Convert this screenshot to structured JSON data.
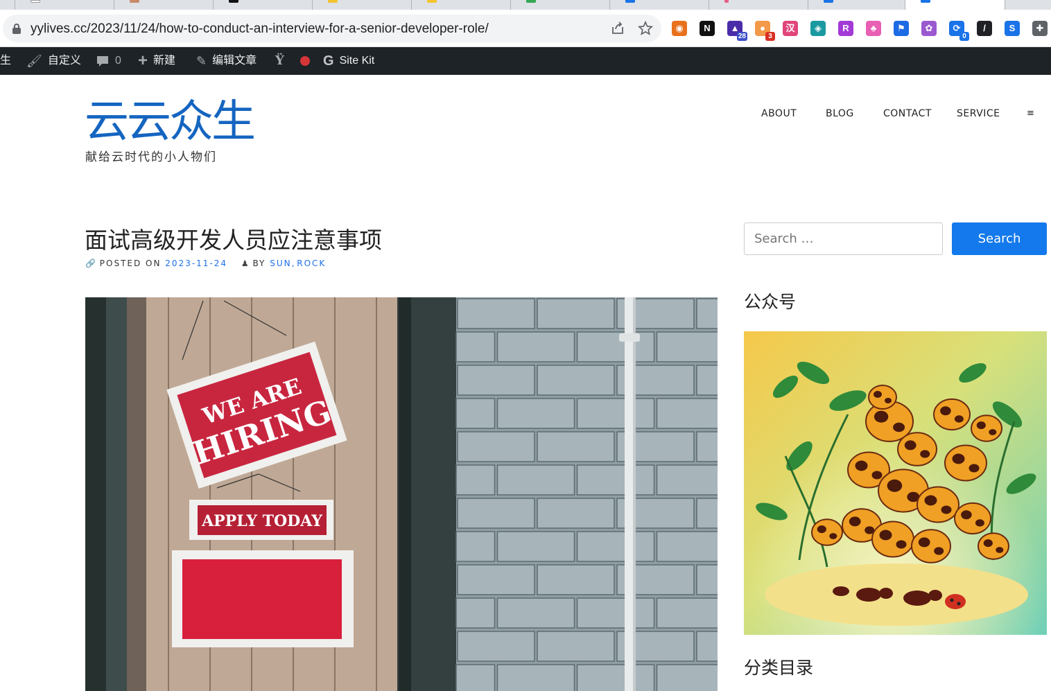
{
  "browser": {
    "url": "yylives.cc/2023/11/24/how-to-conduct-an-interview-for-a-senior-developer-role/",
    "extensions": [
      {
        "name": "circle-extension-icon",
        "color": "#e8711c",
        "glyph": "◉",
        "badge": ""
      },
      {
        "name": "notion-extension-icon",
        "color": "#111111",
        "glyph": "N",
        "badge": ""
      },
      {
        "name": "graduation-cap-extension-icon",
        "color": "#4b2ca8",
        "glyph": "▲",
        "badge": "28",
        "badge_color": "#3c4ec9"
      },
      {
        "name": "cloud-extension-icon",
        "color": "#f2994a",
        "glyph": "●",
        "badge": "3",
        "badge_color": "#d93025"
      },
      {
        "name": "translate-extension-icon",
        "color": "#e0457b",
        "glyph": "汉",
        "badge": ""
      },
      {
        "name": "gem-extension-icon",
        "color": "#1a9aa0",
        "glyph": "◈",
        "badge": ""
      },
      {
        "name": "lr-extension-icon",
        "color": "#a33ad6",
        "glyph": "R",
        "badge": ""
      },
      {
        "name": "paw-extension-icon",
        "color": "#e85fb4",
        "glyph": "♣",
        "badge": ""
      },
      {
        "name": "flag-extension-icon",
        "color": "#1d6ae5",
        "glyph": "⚑",
        "badge": ""
      },
      {
        "name": "openai-extension-icon",
        "color": "#9b59d0",
        "glyph": "✿",
        "badge": ""
      },
      {
        "name": "sync-extension-icon",
        "color": "#1a73e8",
        "glyph": "⟳",
        "badge": "0",
        "badge_color": "#1a73e8"
      },
      {
        "name": "slash-extension-icon",
        "color": "#202124",
        "glyph": "/",
        "badge": ""
      },
      {
        "name": "s-extension-icon",
        "color": "#1a73e8",
        "glyph": "S",
        "badge": ""
      },
      {
        "name": "puzzle-extension-icon",
        "color": "#5f6368",
        "glyph": "✚",
        "badge": ""
      }
    ]
  },
  "adminbar": {
    "site_fragment": "生",
    "customize": "自定义",
    "comments_count": "0",
    "new": "新建",
    "edit_post": "编辑文章",
    "sitekit": "Site Kit"
  },
  "site": {
    "title": "云云众生",
    "description": "献给云时代的小人物们"
  },
  "nav": {
    "about": "ABOUT",
    "blog": "BLOG",
    "contact": "CONTACT",
    "service": "SERVICE",
    "menu": "≡"
  },
  "post": {
    "title": "面试高级开发人员应注意事项",
    "posted_on_label": "POSTED ON",
    "date": "2023-11-24",
    "by_label": "BY",
    "author1": "SUN",
    "sep": ", ",
    "author2": "ROCK",
    "image": {
      "sign_line1": "WE ARE",
      "sign_line2": "HIRING",
      "apply_text": "APPLY TODAY"
    }
  },
  "sidebar": {
    "search_placeholder": "Search …",
    "search_button": "Search",
    "widget1_title": "公众号",
    "widget2_title": "分类目录"
  }
}
